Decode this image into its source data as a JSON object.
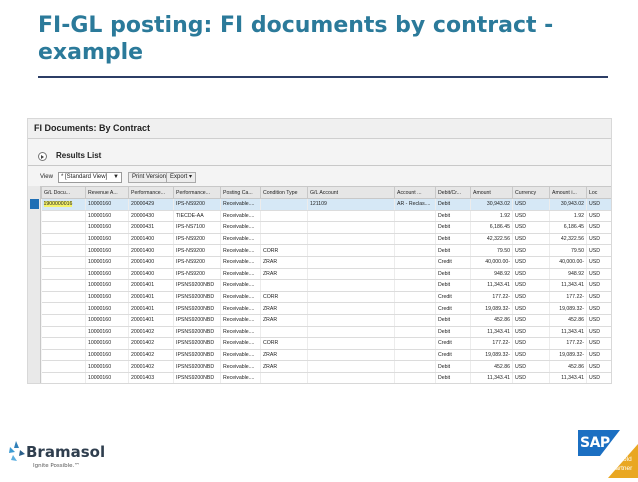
{
  "slide": {
    "title": "FI-GL posting: FI documents by contract - example"
  },
  "app": {
    "title": "FI Documents: By Contract",
    "results_label": "Results List",
    "toolbar": {
      "view_label": "View",
      "view_value": "* [Standard View]",
      "print_label": "Print Version",
      "export_label": "Export"
    }
  },
  "table": {
    "columns": [
      "G/L Docu...",
      "Revenue A...",
      "Performance...",
      "Performance...",
      "Posting Ca...",
      "Condition Type",
      "G/L Account",
      "Account ...",
      "Debit/Cr...",
      "Amount",
      "Currency",
      "Amount i...",
      "Loc"
    ],
    "rows": [
      [
        "1900000016",
        "10000160",
        "20000429",
        "IPS-NS9200",
        "Receivable....",
        "",
        "121109",
        "AR - Reclas....",
        "Debit",
        "30,943.02",
        "USD",
        "30,943.02",
        "USD"
      ],
      [
        "",
        "10000160",
        "20000430",
        "TIECDE-AA",
        "Receivable....",
        "",
        "",
        "",
        "Debit",
        "1.92",
        "USD",
        "1.92",
        "USD"
      ],
      [
        "",
        "10000160",
        "20000431",
        "IPS-NS7100",
        "Receivable....",
        "",
        "",
        "",
        "Debit",
        "6,186.45",
        "USD",
        "6,186.45",
        "USD"
      ],
      [
        "",
        "10000160",
        "20001400",
        "IPS-NS9200",
        "Receivable....",
        "",
        "",
        "",
        "Debit",
        "42,322.56",
        "USD",
        "42,322.56",
        "USD"
      ],
      [
        "",
        "10000160",
        "20001400",
        "IPS-NS9200",
        "Receivable....",
        "CORR",
        "",
        "",
        "Debit",
        "79.50",
        "USD",
        "79.50",
        "USD"
      ],
      [
        "",
        "10000160",
        "20001400",
        "IPS-NS9200",
        "Receivable....",
        "ZRAR",
        "",
        "",
        "Credit",
        "40,000.00-",
        "USD",
        "40,000.00-",
        "USD"
      ],
      [
        "",
        "10000160",
        "20001400",
        "IPS-NS9200",
        "Receivable....",
        "ZRAR",
        "",
        "",
        "Debit",
        "948.92",
        "USD",
        "948.92",
        "USD"
      ],
      [
        "",
        "10000160",
        "20001401",
        "IPSNS9200NBD",
        "Receivable....",
        "",
        "",
        "",
        "Debit",
        "11,343.41",
        "USD",
        "11,343.41",
        "USD"
      ],
      [
        "",
        "10000160",
        "20001401",
        "IPSNS9200NBD",
        "Receivable....",
        "CORR",
        "",
        "",
        "Credit",
        "177.22-",
        "USD",
        "177.22-",
        "USD"
      ],
      [
        "",
        "10000160",
        "20001401",
        "IPSNS9200NBD",
        "Receivable....",
        "ZRAR",
        "",
        "",
        "Credit",
        "19,089.32-",
        "USD",
        "19,089.32-",
        "USD"
      ],
      [
        "",
        "10000160",
        "20001401",
        "IPSNS9200NBD",
        "Receivable....",
        "ZRAR",
        "",
        "",
        "Debit",
        "452.86",
        "USD",
        "452.86",
        "USD"
      ],
      [
        "",
        "10000160",
        "20001402",
        "IPSNS9200NBD",
        "Receivable....",
        "",
        "",
        "",
        "Debit",
        "11,343.41",
        "USD",
        "11,343.41",
        "USD"
      ],
      [
        "",
        "10000160",
        "20001402",
        "IPSNS9200NBD",
        "Receivable....",
        "CORR",
        "",
        "",
        "Credit",
        "177.22-",
        "USD",
        "177.22-",
        "USD"
      ],
      [
        "",
        "10000160",
        "20001402",
        "IPSNS9200NBD",
        "Receivable....",
        "ZRAR",
        "",
        "",
        "Credit",
        "19,089.32-",
        "USD",
        "19,089.32-",
        "USD"
      ],
      [
        "",
        "10000160",
        "20001402",
        "IPSNS9200NBD",
        "Receivable....",
        "ZRAR",
        "",
        "",
        "Debit",
        "452.86",
        "USD",
        "452.86",
        "USD"
      ],
      [
        "",
        "10000160",
        "20001403",
        "IPSNS9200NBD",
        "Receivable....",
        "",
        "",
        "",
        "Debit",
        "11,343.41",
        "USD",
        "11,343.41",
        "USD"
      ]
    ]
  },
  "footer": {
    "brand": "Bramasol",
    "tagline": "Ignite Possible.™",
    "sap": "SAP",
    "partner_line1": "Gold",
    "partner_line2": "Partner"
  },
  "colors": {
    "title": "#2b7a9a",
    "rule": "#2c3e66",
    "selection": "#1f6fb5",
    "highlight": "#f5f36a",
    "sap_blue": "#1b6fc2",
    "gold": "#e9a722"
  }
}
